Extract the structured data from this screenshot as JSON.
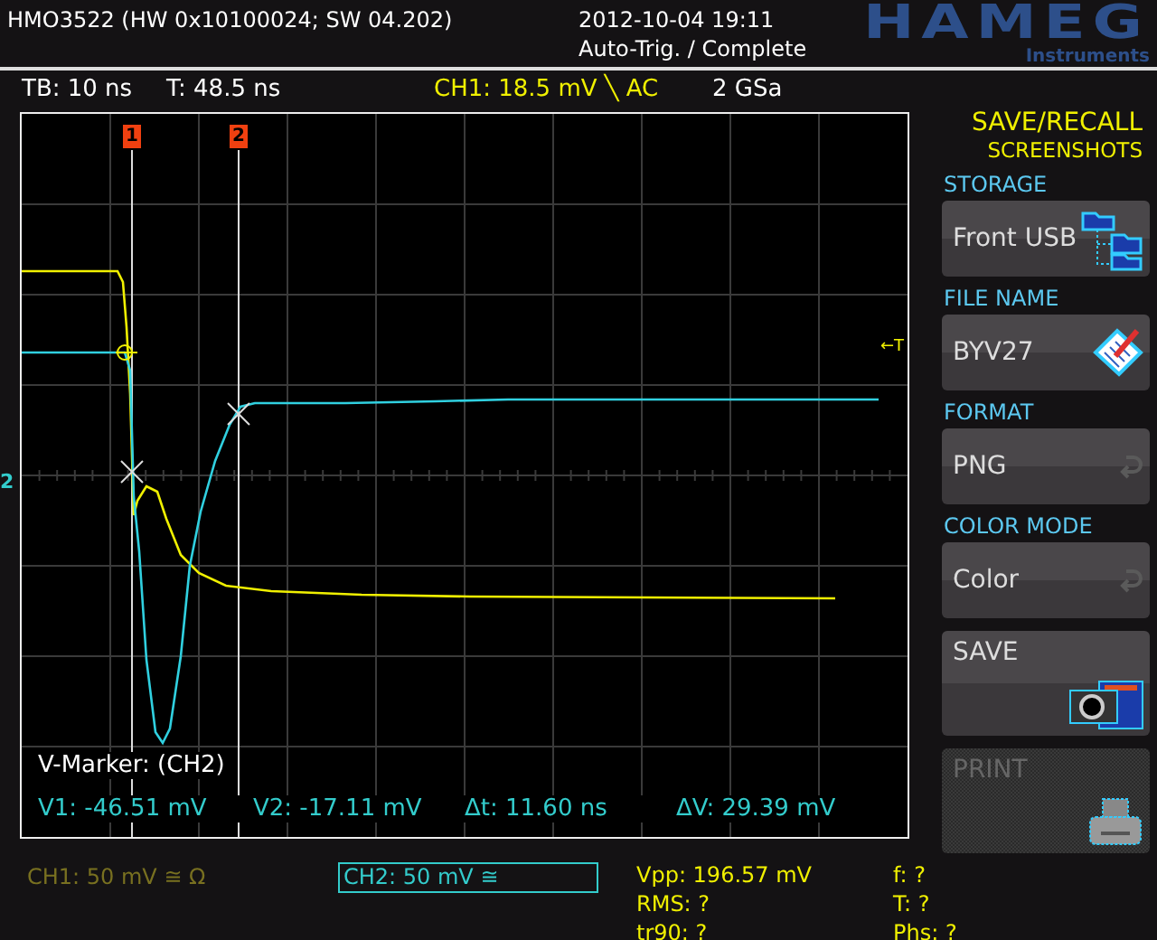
{
  "header": {
    "model": "HMO3522 (HW 0x10100024; SW 04.202)",
    "datetime": "2012-10-04 19:11",
    "status": "Auto-Trig. / Complete",
    "logo": "HAMEG",
    "logo_sub": "Instruments"
  },
  "settings": [
    {
      "text": "TB: 10 ns",
      "color": "#ffffff"
    },
    {
      "text": "T: 48.5 ns",
      "color": "#ffffff"
    },
    {
      "text": "CH1: 18.5 mV ╲ AC",
      "color": "#f0f000"
    },
    {
      "text": "2 GSa",
      "color": "#ffffff"
    }
  ],
  "plot": {
    "markers": [
      "1",
      "2"
    ],
    "channel_marker": "2",
    "trigger_marker": "←T",
    "cursor_title": "V-Marker: (CH2)",
    "readouts": [
      "V1: -46.51 mV",
      "V2: -17.11 mV",
      "Δt: 11.60 ns",
      "ΔV: 29.39 mV"
    ]
  },
  "channels": [
    {
      "label": "CH1: 50 mV ≅ Ω",
      "selected": false
    },
    {
      "label": "CH2: 50 mV ≅",
      "selected": true
    }
  ],
  "measurements": [
    "Vpp: 196.57 mV",
    "f: ?",
    "RMS: ?",
    "T: ?",
    "tr90: ?",
    "Phs: ?"
  ],
  "menu": {
    "title": "SAVE/RECALL",
    "subtitle": "SCREENSHOTS",
    "items": [
      {
        "kind": "select",
        "label": "STORAGE",
        "value": "Front USB"
      },
      {
        "kind": "select",
        "label": "FILE NAME",
        "value": "BYV27"
      },
      {
        "kind": "select",
        "label": "FORMAT",
        "value": "PNG"
      },
      {
        "kind": "select",
        "label": "COLOR MODE",
        "value": "Color"
      },
      {
        "kind": "action",
        "value": "SAVE",
        "disabled": false
      },
      {
        "kind": "action",
        "value": "PRINT",
        "disabled": true
      }
    ]
  }
}
